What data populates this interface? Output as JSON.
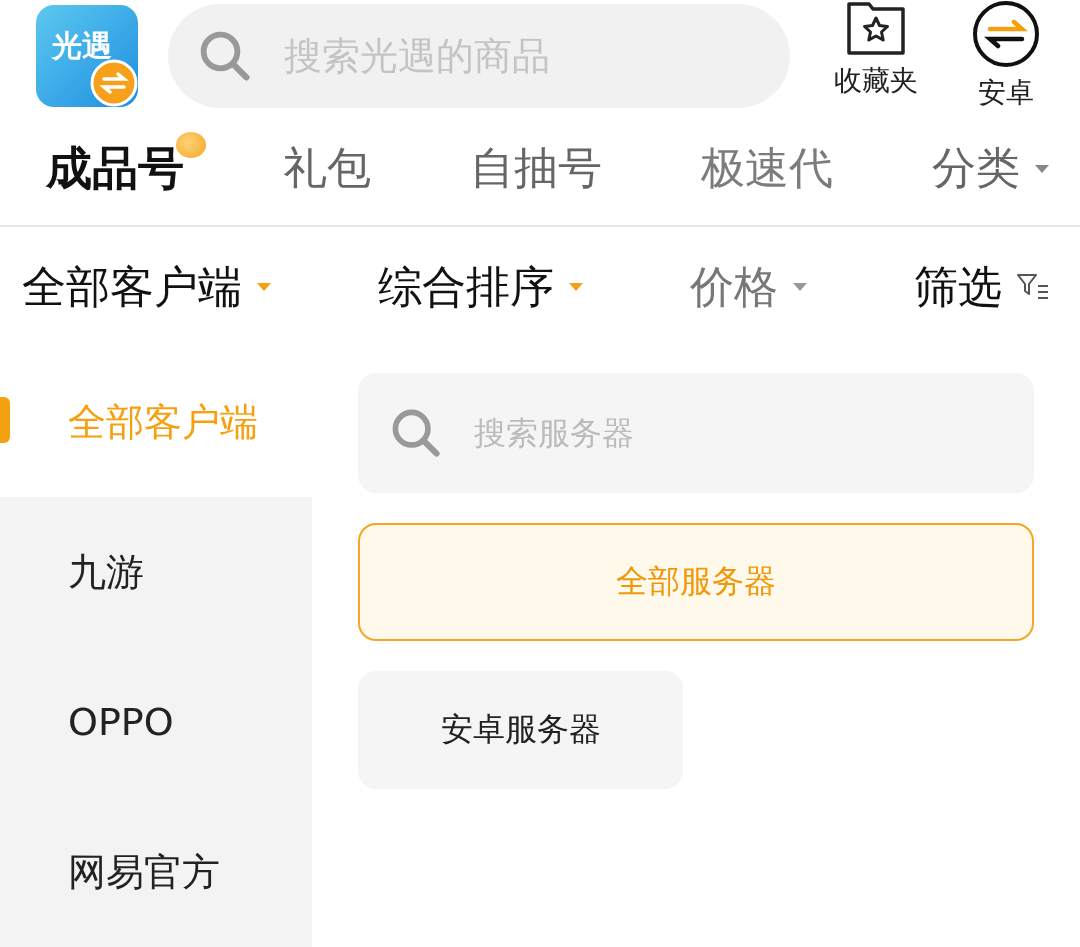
{
  "header": {
    "logo": {
      "text": "光遇"
    },
    "search": {
      "placeholder": "搜索光遇的商品"
    },
    "actions": [
      {
        "kind": "favorites",
        "label": "收藏夹"
      },
      {
        "kind": "platform",
        "label": "安卓"
      }
    ]
  },
  "tabs": [
    {
      "label": "成品号",
      "selected": true,
      "kind": "new"
    },
    {
      "label": "礼包",
      "selected": false,
      "kind": "plain"
    },
    {
      "label": "自抽号",
      "selected": false,
      "kind": "plain"
    },
    {
      "label": "极速代",
      "selected": false,
      "kind": "faded"
    },
    {
      "label": "分类",
      "selected": false,
      "kind": "menu"
    }
  ],
  "filters": [
    {
      "label": "全部客户端",
      "active": true,
      "kind": "dropdown"
    },
    {
      "label": "综合排序",
      "active": true,
      "kind": "dropdown"
    },
    {
      "label": "价格",
      "active": false,
      "kind": "dropdown"
    },
    {
      "label": "筛选",
      "active": true,
      "kind": "filter"
    }
  ],
  "sidebar": {
    "items": [
      {
        "label": "全部客户端",
        "selected": true
      },
      {
        "label": "九游",
        "selected": false
      },
      {
        "label": "OPPO",
        "selected": false
      },
      {
        "label": "网易官方",
        "selected": false
      }
    ]
  },
  "servers": {
    "search": {
      "placeholder": "搜索服务器"
    },
    "items": [
      {
        "label": "全部服务器",
        "selected": true
      },
      {
        "label": "安卓服务器",
        "selected": false
      }
    ]
  }
}
